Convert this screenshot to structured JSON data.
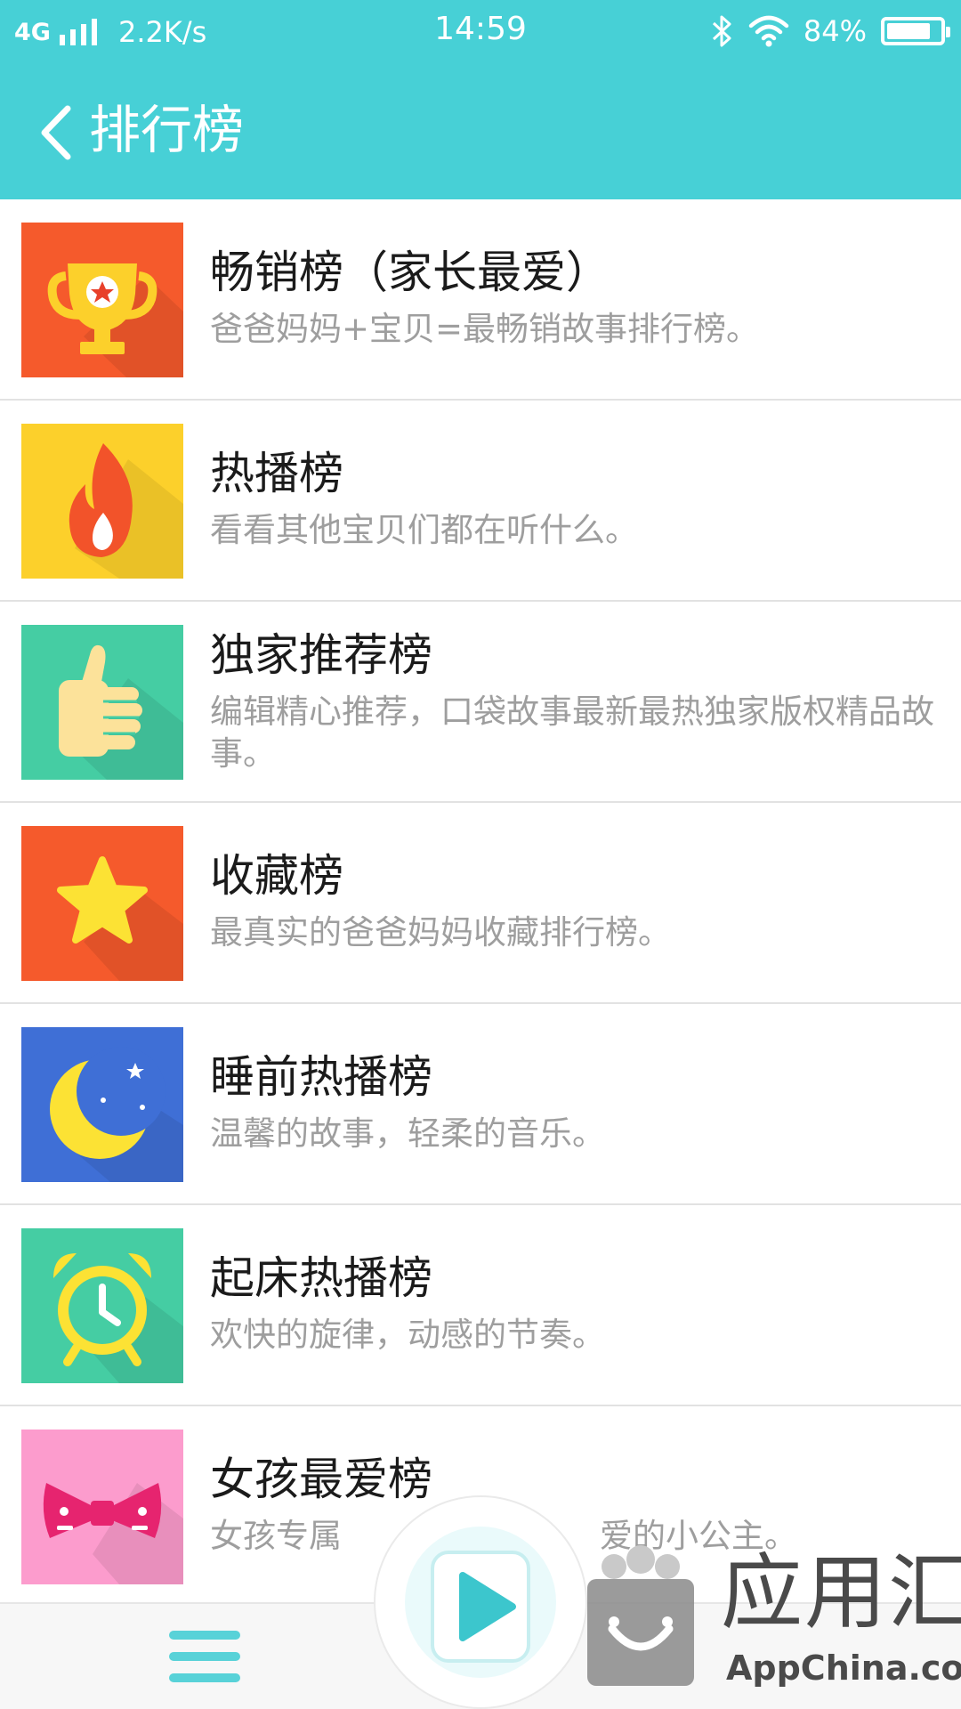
{
  "status_bar": {
    "network": "4G",
    "speed": "2.2K/s",
    "time": "14:59",
    "battery": "84%",
    "battery_level_percent": 84
  },
  "header": {
    "title": "排行榜",
    "back_icon": "chevron-left-icon"
  },
  "colors": {
    "header_bg": "#47d0d6",
    "title_text": "#1b1b1b",
    "subtitle_text": "#9e9e9e",
    "divider": "#e2e2e2"
  },
  "rankings": [
    {
      "title": "畅销榜（家长最爱）",
      "subtitle": "爸爸妈妈+宝贝=最畅销故事排行榜。",
      "icon": "trophy-icon",
      "color": "#f55a2c"
    },
    {
      "title": "热播榜",
      "subtitle": "看看其他宝贝们都在听什么。",
      "icon": "flame-icon",
      "color": "#fcd02b"
    },
    {
      "title": "独家推荐榜",
      "subtitle": "编辑精心推荐，口袋故事最新最热独家版权精品故事。",
      "icon": "thumbs-up-icon",
      "color": "#45cda3"
    },
    {
      "title": "收藏榜",
      "subtitle": "最真实的爸爸妈妈收藏排行榜。",
      "icon": "star-icon",
      "color": "#f55a2c"
    },
    {
      "title": "睡前热播榜",
      "subtitle": "温馨的故事，轻柔的音乐。",
      "icon": "moon-icon",
      "color": "#3f6fd6"
    },
    {
      "title": "起床热播榜",
      "subtitle": "欢快的旋律，动感的节奏。",
      "icon": "alarm-clock-icon",
      "color": "#45cda3"
    },
    {
      "title": "女孩最爱榜",
      "subtitle": "女孩专属",
      "subtitle_tail": "爱的小公主。",
      "icon": "bow-tie-icon",
      "color": "#fc9ccd"
    }
  ],
  "bottom_bar": {
    "menu_icon": "hamburger-menu-icon",
    "play_icon": "play-icon"
  },
  "watermark": {
    "cn": "应用汇",
    "en": "AppChina.com"
  }
}
